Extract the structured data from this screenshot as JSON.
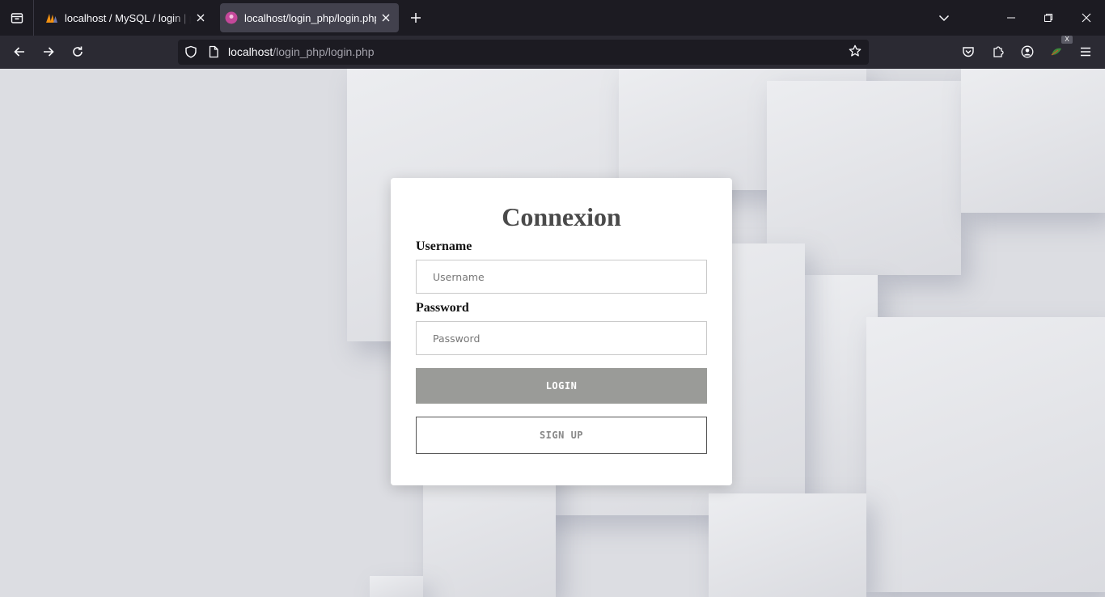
{
  "browser": {
    "tabs": [
      {
        "title": "localhost / MySQL / login | phpMyAdmin",
        "active": false,
        "favicon": "phpmyadmin-icon"
      },
      {
        "title": "localhost/login_php/login.php",
        "active": true,
        "favicon": "page-favicon-icon"
      }
    ],
    "url": {
      "host": "localhost",
      "path": "/login_php/login.php"
    },
    "extension_badge": "X"
  },
  "form": {
    "title": "Connexion",
    "username_label": "Username",
    "username_placeholder": "Username",
    "username_value": "",
    "password_label": "Password",
    "password_placeholder": "Password",
    "password_value": "",
    "login_label": "LOGIN",
    "signup_label": "SIGN UP"
  },
  "colors": {
    "tabbar_bg": "#1c1b22",
    "navbar_bg": "#2b2a33",
    "active_tab_bg": "#42414d",
    "login_button_bg": "#9a9b98",
    "page_bg": "#dcdde2"
  }
}
